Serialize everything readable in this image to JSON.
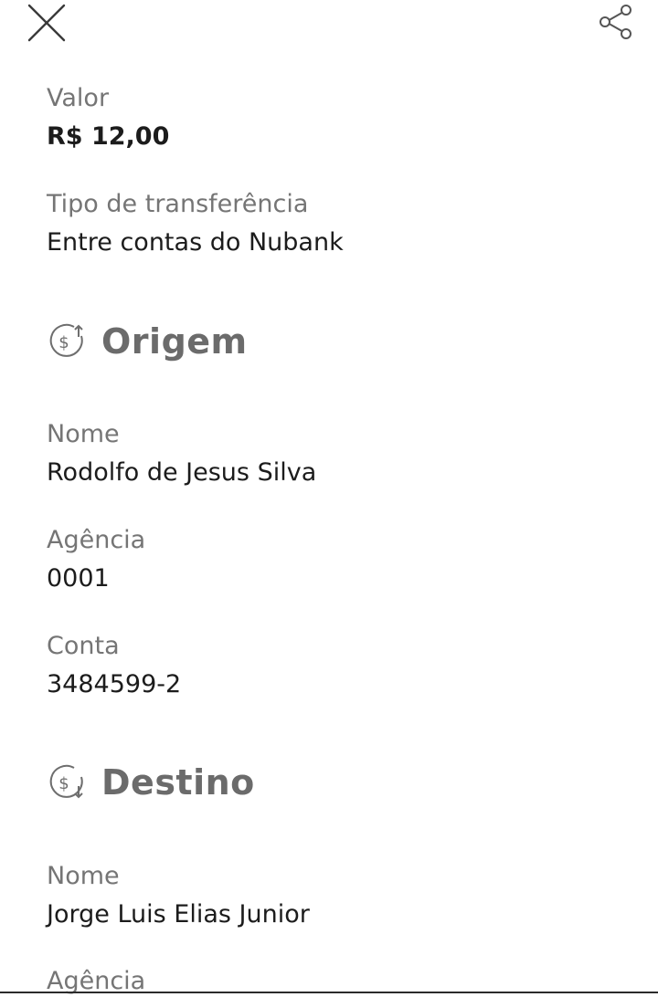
{
  "header": {
    "close_icon": "close-icon",
    "share_icon": "share-icon"
  },
  "summary": {
    "valor_label": "Valor",
    "valor_value": "R$ 12,00",
    "tipo_label": "Tipo de transferência",
    "tipo_value": "Entre contas do Nubank"
  },
  "origem": {
    "title": "Origem",
    "icon": "money-out-icon",
    "nome_label": "Nome",
    "nome_value": "Rodolfo de Jesus Silva",
    "agencia_label": "Agência",
    "agencia_value": "0001",
    "conta_label": "Conta",
    "conta_value": "3484599-2"
  },
  "destino": {
    "title": "Destino",
    "icon": "money-in-icon",
    "nome_label": "Nome",
    "nome_value": "Jorge Luis Elias Junior",
    "agencia_label": "Agência"
  }
}
